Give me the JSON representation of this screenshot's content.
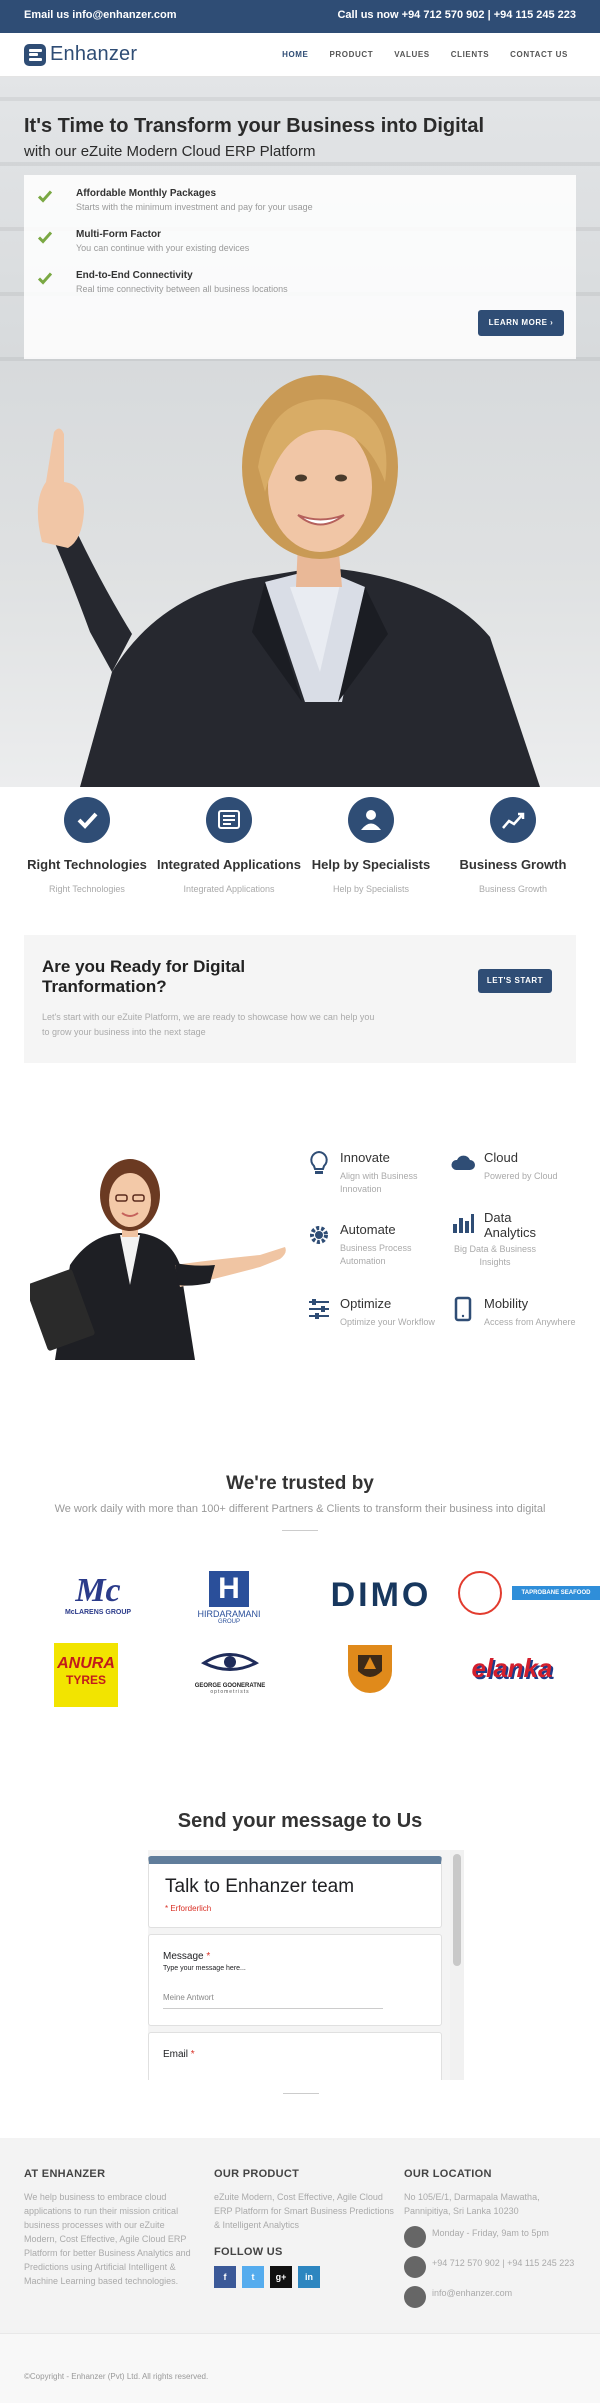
{
  "topbar": {
    "email": "Email us info@enhanzer.com",
    "phone": "Call us now +94 712 570 902 | +94 115 245 223"
  },
  "nav": {
    "brand": "Enhanzer",
    "items": [
      "HOME",
      "PRODUCT",
      "VALUES",
      "CLIENTS",
      "CONTACT US"
    ],
    "active": "HOME"
  },
  "hero": {
    "title": "It's Time to Transform your Business into Digital",
    "subtitle": "with our eZuite Modern Cloud ERP Platform",
    "features": [
      {
        "title": "Affordable Monthly Packages",
        "desc": "Starts with the minimum investment and pay for your usage"
      },
      {
        "title": "Multi-Form Factor",
        "desc": "You can continue with your existing devices"
      },
      {
        "title": "End-to-End Connectivity",
        "desc": "Real time connectivity between all business locations"
      }
    ],
    "cta": "LEARN MORE ›"
  },
  "services": [
    {
      "title": "Right Technologies",
      "desc": "Right Technologies",
      "icon": "check-icon"
    },
    {
      "title": "Integrated Applications",
      "desc": "Integrated Applications",
      "icon": "application-icon"
    },
    {
      "title": "Help by Specialists",
      "desc": "Help by Specialists",
      "icon": "specialist-icon"
    },
    {
      "title": "Business Growth",
      "desc": "Business Growth",
      "icon": "growth-chart-icon"
    }
  ],
  "ready": {
    "title": "Are you Ready for Digital Tranformation?",
    "text": "Let's start with our eZuite Platform, we are ready to showcase how we can help you to grow your business into the next stage",
    "cta": "LET'S START"
  },
  "benefits": [
    {
      "title": "Innovate",
      "desc": "Align with Business Innovation",
      "icon": "lightbulb-icon"
    },
    {
      "title": "Cloud",
      "desc": "Powered by Cloud",
      "icon": "cloud-icon"
    },
    {
      "title": "Automate",
      "desc": "Business Process Automation",
      "icon": "gear-icon"
    },
    {
      "title": "Data Analytics",
      "desc": "Big Data & Business Insights",
      "icon": "bar-chart-icon"
    },
    {
      "title": "Optimize",
      "desc": "Optimize your Workflow",
      "icon": "sliders-icon"
    },
    {
      "title": "Mobility",
      "desc": "Access from Anywhere",
      "icon": "mobile-icon"
    }
  ],
  "trusted": {
    "title": "We're trusted by",
    "subtitle": "We work daily with more than 100+ different Partners & Clients to transform their business into digital"
  },
  "clients": {
    "mclarens": {
      "mark": "Mc",
      "name": "McLARENS GROUP"
    },
    "hirdaramani": {
      "mark": "H",
      "name": "HIRDARAMANI",
      "sub": "GROUP"
    },
    "dimo": {
      "mark": "DIMO"
    },
    "taprobane": {
      "name": "TAPROBANE SEAFOOD"
    },
    "anura": {
      "name": "ANURA",
      "sub": "TYRES"
    },
    "george": {
      "name": "GEORGE GOONERATNE",
      "sub": "optometrists"
    },
    "elanka": {
      "name": "elanka"
    }
  },
  "contact": {
    "title": "Send your message to Us",
    "form_title": "Talk to Enhanzer team",
    "required": "* Erforderlich",
    "message_label": "Message",
    "message_hint": "Type your message here...",
    "message_placeholder": "Meine Antwort",
    "email_label": "Email"
  },
  "footer": {
    "about_title": "AT ENHANZER",
    "about_text": "We help business to embrace cloud applications to run their mission critical business processes with our eZuite Modern, Cost Effective, Agile Cloud ERP Platform for better Business Analytics and Predictions using Artificial Intelligent & Machine Learning based technologies.",
    "product_title": "OUR PRODUCT",
    "product_text": "eZuite Modern, Cost Effective, Agile Cloud ERP Platform for Smart Business Predictions & Intelligent Analytics",
    "follow_title": "FOLLOW US",
    "social": [
      "f",
      "t",
      "g+",
      "in"
    ],
    "location_title": "OUR LOCATION",
    "address": "No 105/E/1, Darmapala Mawatha, Pannipitiya, Sri Lanka 10230",
    "hours": "Monday - Friday, 9am to 5pm",
    "phone": "+94 712 570 902 | +94 115 245 223",
    "email": "info@enhanzer.com",
    "copyright": "©Copyright - Enhanzer (Pvt) Ltd. All rights reserved."
  },
  "colors": {
    "primary": "#2f4d75",
    "check": "#7aa843"
  }
}
